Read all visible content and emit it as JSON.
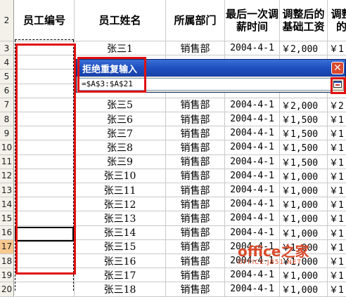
{
  "header_row": {
    "row_num": "2",
    "columns": [
      "员工编号",
      "员工姓名",
      "所属部门",
      "最后一次调薪时间",
      "调整后的基础工资",
      "调整的"
    ]
  },
  "rows": [
    {
      "num": "3",
      "name": "张三1",
      "dept": "销售部",
      "date": "2004-4-1",
      "wage": "￥2,000",
      "extra": "￥1"
    },
    {
      "num": "4",
      "name": "",
      "dept": "",
      "date": "",
      "wage": "",
      "extra": ""
    },
    {
      "num": "5",
      "name": "",
      "dept": "",
      "date": "",
      "wage": "",
      "extra": ""
    },
    {
      "num": "6",
      "name": "",
      "dept": "",
      "date": "",
      "wage": "",
      "extra": ""
    },
    {
      "num": "7",
      "name": "张三5",
      "dept": "销售部",
      "date": "2004-4-1",
      "wage": "￥2,000",
      "extra": "￥2"
    },
    {
      "num": "8",
      "name": "张三6",
      "dept": "销售部",
      "date": "2004-4-1",
      "wage": "￥1,500",
      "extra": "￥1"
    },
    {
      "num": "9",
      "name": "张三7",
      "dept": "销售部",
      "date": "2004-4-1",
      "wage": "￥1,500",
      "extra": "￥1"
    },
    {
      "num": "10",
      "name": "张三8",
      "dept": "销售部",
      "date": "2004-4-1",
      "wage": "￥1,500",
      "extra": "￥1"
    },
    {
      "num": "11",
      "name": "张三9",
      "dept": "销售部",
      "date": "2004-4-1",
      "wage": "￥1,500",
      "extra": "￥1"
    },
    {
      "num": "12",
      "name": "张三10",
      "dept": "销售部",
      "date": "2004-4-1",
      "wage": "￥1,000",
      "extra": "￥1"
    },
    {
      "num": "13",
      "name": "张三11",
      "dept": "销售部",
      "date": "2004-4-1",
      "wage": "￥1,000",
      "extra": "￥1"
    },
    {
      "num": "14",
      "name": "张三12",
      "dept": "销售部",
      "date": "2004-4-1",
      "wage": "￥1,000",
      "extra": "￥1"
    },
    {
      "num": "15",
      "name": "张三13",
      "dept": "销售部",
      "date": "2004-4-1",
      "wage": "￥1,000",
      "extra": "￥1"
    },
    {
      "num": "16",
      "name": "张三14",
      "dept": "销售部",
      "date": "2004-4-1",
      "wage": "￥1,000",
      "extra": "￥1"
    },
    {
      "num": "17",
      "name": "张三15",
      "dept": "销售部",
      "date": "2004-4-1",
      "wage": "￥1,000",
      "extra": "￥1"
    },
    {
      "num": "18",
      "name": "张三16",
      "dept": "销售部",
      "date": "2004-4-1",
      "wage": "￥1,000",
      "extra": "￥1"
    },
    {
      "num": "19",
      "name": "张三17",
      "dept": "销售部",
      "date": "2004-4-1",
      "wage": "￥1,000",
      "extra": "￥1"
    },
    {
      "num": "20",
      "name": "张三18",
      "dept": "销售部",
      "date": "2004-4-1",
      "wage": "￥1,000",
      "extra": "￥1"
    }
  ],
  "selected_row": "17",
  "dialog": {
    "title": "拒绝重复输入",
    "input_value": "=$A$3:$A$21",
    "close_icon": "close-icon",
    "collapse_icon": "range-collapse-icon"
  },
  "watermark": {
    "main": "office之家",
    "sub": "OFFICE.JB51.NET"
  },
  "colors": {
    "highlight_red": "#e01010",
    "dialog_title_blue": "#1f4fbf",
    "selected_row_header": "#f7c88e"
  }
}
